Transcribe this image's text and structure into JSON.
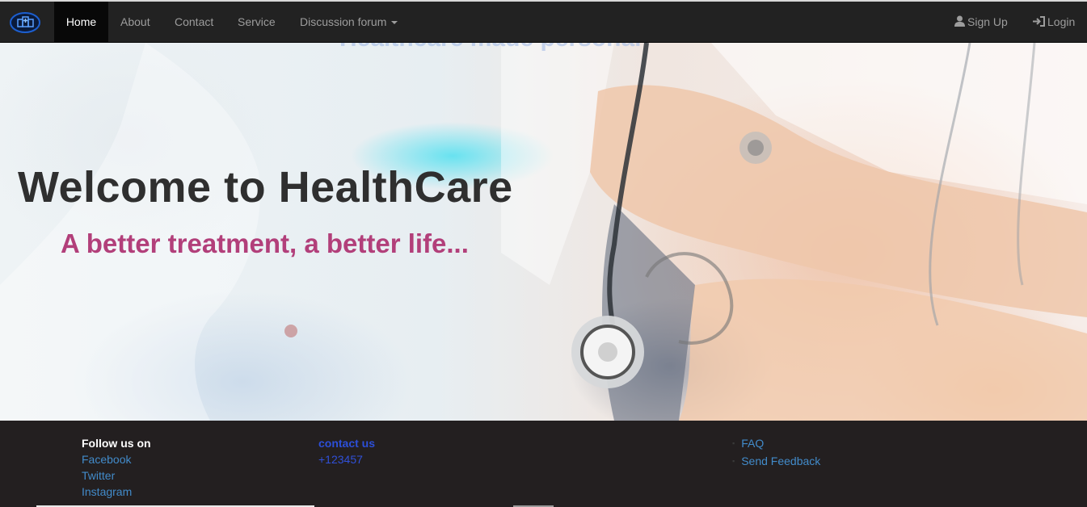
{
  "nav": {
    "home": "Home",
    "about": "About",
    "contact": "Contact",
    "service": "Service",
    "forum": "Discussion forum",
    "signup": "Sign Up",
    "login": "Login"
  },
  "hero": {
    "faded_text": "Healthcare made personal",
    "title": "Welcome to HealthCare",
    "subtitle": "A better treatment, a better life..."
  },
  "footer": {
    "follow_heading": "Follow us on",
    "social": [
      "Facebook",
      "Twitter",
      "Instagram"
    ],
    "contact_heading": "contact us",
    "phone": "+123457",
    "links": [
      "FAQ",
      "Send Feedback"
    ]
  },
  "colors": {
    "navbar": "#222222",
    "footer": "#231f20",
    "link": "#428bca",
    "subtitle": "#b23f7a"
  },
  "icons": {
    "brand": "hospital-logo-icon",
    "signup": "user-icon",
    "login": "login-icon",
    "forum": "caret-down-icon"
  }
}
